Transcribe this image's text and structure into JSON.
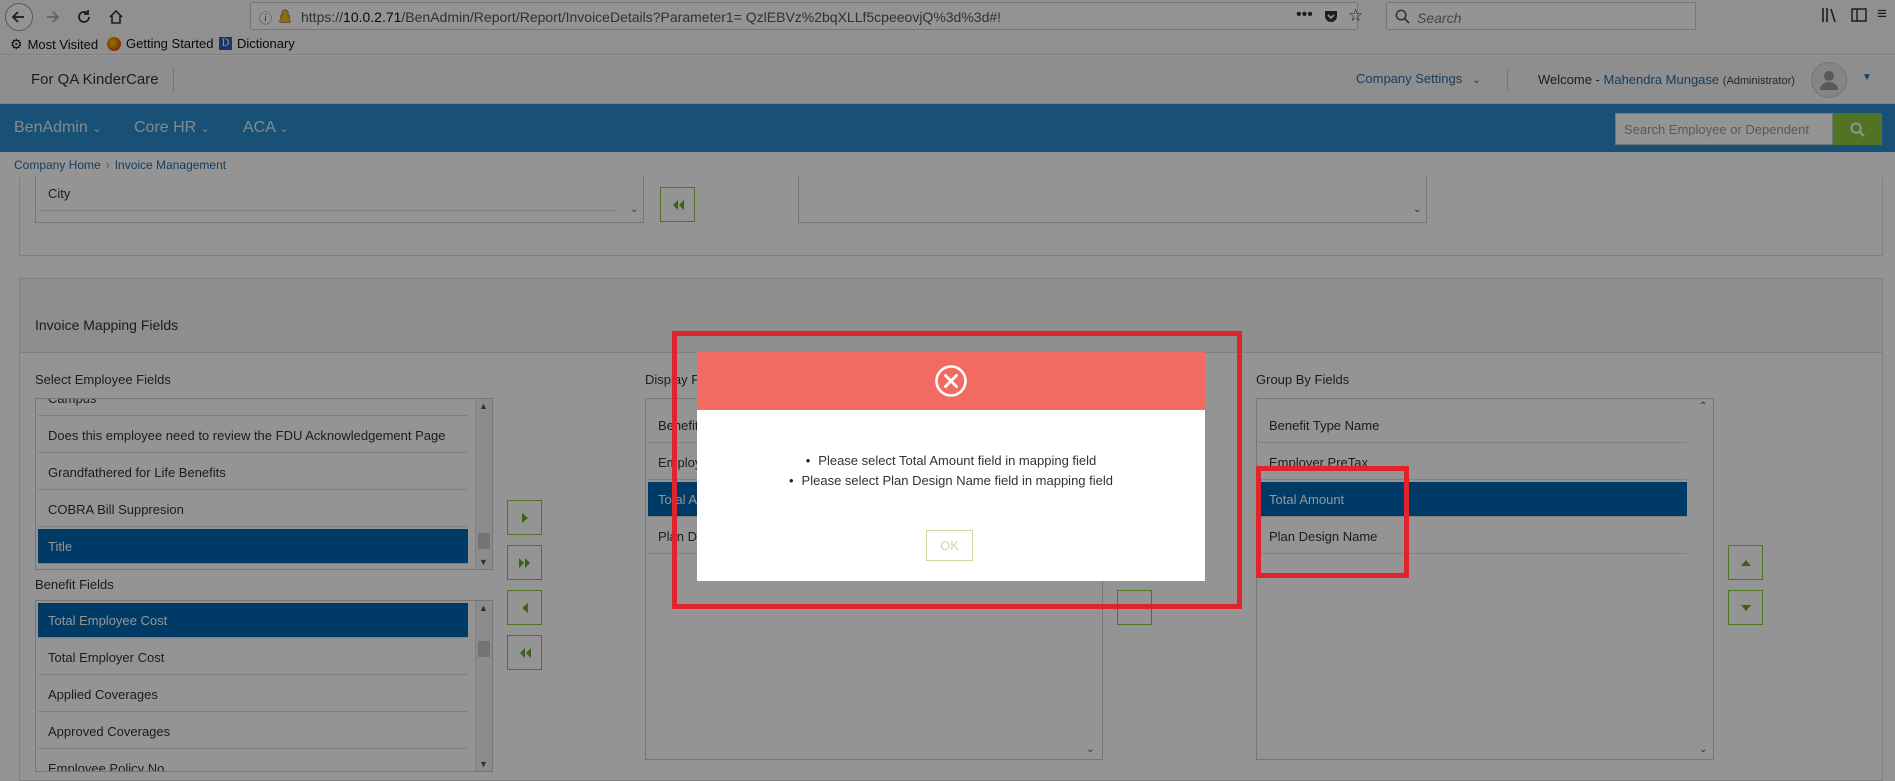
{
  "browser": {
    "url_prefix": "https://",
    "url_host": "10.0.2.71",
    "url_path": "/BenAdmin/Report/Report/InvoiceDetails?Parameter1= QzlEBVz%2bqXLLf5cpeeovjQ%3d%3d#!",
    "search_placeholder": "Search",
    "bookmarks": [
      "Most Visited",
      "Getting Started",
      "Dictionary"
    ]
  },
  "header": {
    "company": "For QA KinderCare",
    "company_settings": "Company Settings",
    "welcome": "Welcome -",
    "user": "Mahendra Mungase",
    "role": "(Administrator)"
  },
  "nav": {
    "items": [
      "BenAdmin",
      "Core HR",
      "ACA"
    ],
    "search_placeholder": "Search Employee or Dependent"
  },
  "breadcrumb": [
    "Company Home",
    "Invoice Management"
  ],
  "top_section": {
    "visible_row": "City"
  },
  "mapping": {
    "title": "Invoice Mapping Fields",
    "employee_fields_label": "Select Employee Fields",
    "employee_fields": [
      "Campus",
      "Does this employee need to review the FDU Acknowledgement Page",
      "Grandfathered for Life Benefits",
      "COBRA Bill Suppresion",
      "Title"
    ],
    "benefit_fields_label": "Benefit Fields",
    "benefit_fields": [
      "Total Employee Cost",
      "Total Employer Cost",
      "Applied Coverages",
      "Approved Coverages",
      "Employee Policy No"
    ],
    "display_fields_label": "Display F",
    "display_fields": [
      "Benefit",
      "Employ",
      "Total A",
      "Plan De"
    ],
    "group_by_label": "Group By Fields",
    "group_by_fields": [
      "Benefit Type Name",
      "Employer PreTax",
      "Total Amount",
      "Plan Design Name"
    ]
  },
  "modal": {
    "messages": [
      "Please select Total Amount field in mapping field",
      "Please select Plan Design Name field in mapping field"
    ],
    "ok_label": "OK"
  },
  "colors": {
    "nav_blue": "#2c8ccb",
    "selected_row": "#0066b3",
    "modal_header": "#f26b63",
    "accent_green": "#8cc63f",
    "highlight_red": "#e0242b"
  }
}
